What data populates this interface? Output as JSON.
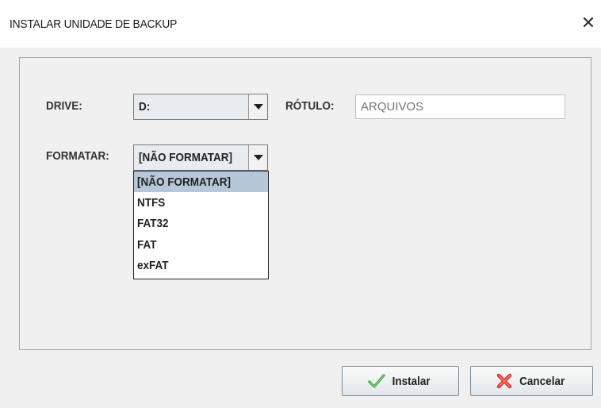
{
  "window": {
    "title": "INSTALAR UNIDADE DE BACKUP",
    "close_glyph": "✕"
  },
  "form": {
    "drive_label": "DRIVE:",
    "drive_value": "D:",
    "label_label": "RÓTULO:",
    "label_placeholder": "ARQUIVOS",
    "format_label": "FORMATAR:",
    "format_value": "[NÃO FORMATAR]"
  },
  "format_dropdown": {
    "options": [
      "[NÃO FORMATAR]",
      "NTFS",
      "FAT32",
      "FAT",
      "exFAT"
    ],
    "selected_index": 0
  },
  "buttons": {
    "install_label": "Instalar",
    "install_icon": "checkmark-icon",
    "cancel_label": "Cancelar",
    "cancel_icon": "x-icon"
  },
  "colors": {
    "selected_option": "#b6c7d9",
    "check_green": "#3aa53a",
    "cancel_red": "#e0312a"
  }
}
